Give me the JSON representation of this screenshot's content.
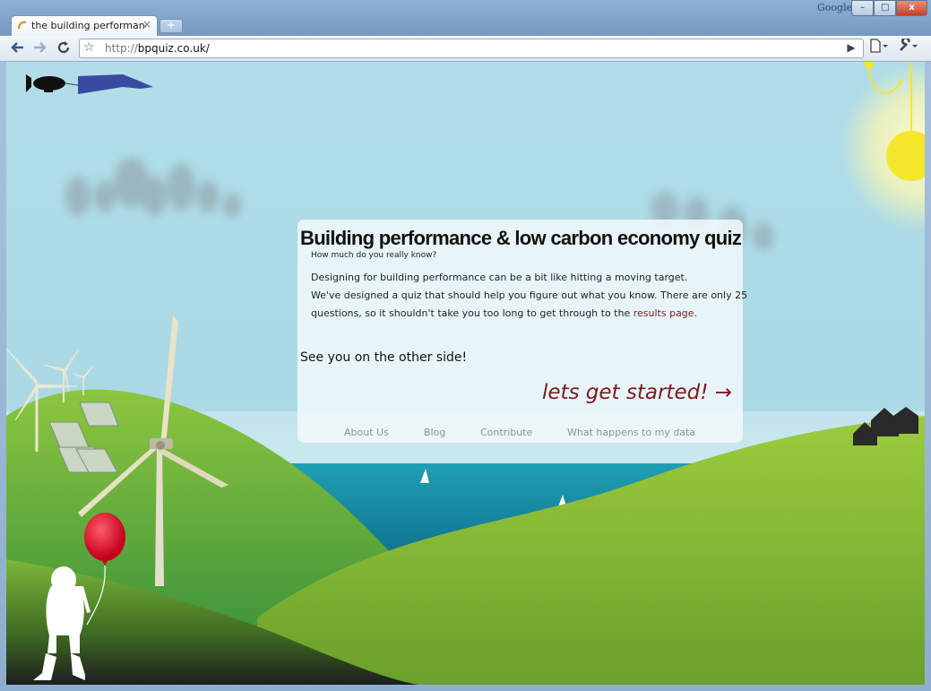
{
  "browser": {
    "tab_title": "the building performanc...",
    "tab_close": "×",
    "new_tab": "+",
    "google_label": "Google",
    "window_buttons": {
      "minimize": "–",
      "maximize": "□",
      "close": "x"
    },
    "url_protocol": "http://",
    "url_host": "bpquiz.co.uk/",
    "icons": [
      "back-icon",
      "forward-icon",
      "reload-icon",
      "star-icon",
      "go-icon",
      "page-menu-icon",
      "wrench-icon"
    ]
  },
  "quiz": {
    "title": "Building performance & low carbon economy quiz",
    "subtitle": "How much do you really know?",
    "paragraph1": "Designing for building performance can be a bit like hitting a moving target.",
    "paragraph2": "We've designed a quiz that should help you figure out what you know. There are only 25",
    "paragraph3_text": "questions, so it shouldn't take you too long to get through to the ",
    "paragraph3_link": "results page",
    "paragraph3_end": ".",
    "see_you": "See you on the other side!",
    "cta": "lets get started! →"
  },
  "footer": {
    "about": "About Us",
    "blog": "Blog",
    "contribute": "Contribute",
    "data": "What happens to my data"
  },
  "colors": {
    "sky": "#b0dde8",
    "sea": "#1b8fa6",
    "hill_green": "#8cc63f",
    "link_red": "#7a1a1f",
    "sun": "#f4e62a",
    "balloon": "#e0142b"
  }
}
